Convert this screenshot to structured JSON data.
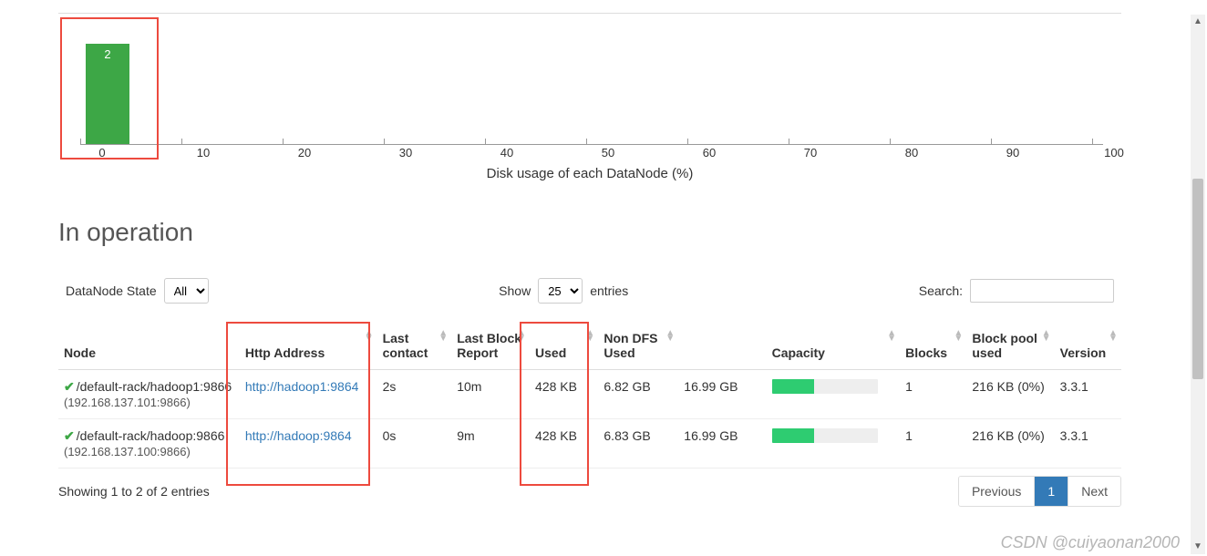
{
  "chart_data": {
    "type": "bar",
    "categories": [
      "0",
      "10",
      "20",
      "30",
      "40",
      "50",
      "60",
      "70",
      "80",
      "90",
      "100"
    ],
    "values": [
      2,
      0,
      0,
      0,
      0,
      0,
      0,
      0,
      0,
      0,
      0
    ],
    "title": "",
    "xlabel": "Disk usage of each DataNode (%)",
    "ylabel": "",
    "ylim": [
      0,
      2
    ]
  },
  "section": {
    "title": "In operation"
  },
  "filters": {
    "state_label": "DataNode State",
    "state_value": "All",
    "show_label": "Show",
    "show_value": "25",
    "entries_label": "entries",
    "search_label": "Search:",
    "search_value": ""
  },
  "table": {
    "headers": {
      "node": "Node",
      "http_address": "Http Address",
      "last_contact": "Last contact",
      "last_block_report": "Last Block Report",
      "used": "Used",
      "non_dfs_used": "Non DFS Used",
      "capacity": "Capacity",
      "blocks": "Blocks",
      "block_pool_used": "Block pool used",
      "version": "Version"
    },
    "rows": [
      {
        "node_path": "/default-rack/hadoop1:9866",
        "node_ip": "(192.168.137.101:9866)",
        "http_address": "http://hadoop1:9864",
        "last_contact": "2s",
        "last_block_report": "10m",
        "used": "428 KB",
        "non_dfs_used": "6.82 GB",
        "capacity_text": "16.99 GB",
        "capacity_pct": 40,
        "blocks": "1",
        "block_pool_used": "216 KB (0%)",
        "version": "3.3.1"
      },
      {
        "node_path": "/default-rack/hadoop:9866",
        "node_ip": "(192.168.137.100:9866)",
        "http_address": "http://hadoop:9864",
        "last_contact": "0s",
        "last_block_report": "9m",
        "used": "428 KB",
        "non_dfs_used": "6.83 GB",
        "capacity_text": "16.99 GB",
        "capacity_pct": 40,
        "blocks": "1",
        "block_pool_used": "216 KB (0%)",
        "version": "3.3.1"
      }
    ],
    "info": "Showing 1 to 2 of 2 entries"
  },
  "pager": {
    "previous": "Previous",
    "page": "1",
    "next": "Next"
  },
  "watermark": "CSDN @cuiyaonan2000"
}
